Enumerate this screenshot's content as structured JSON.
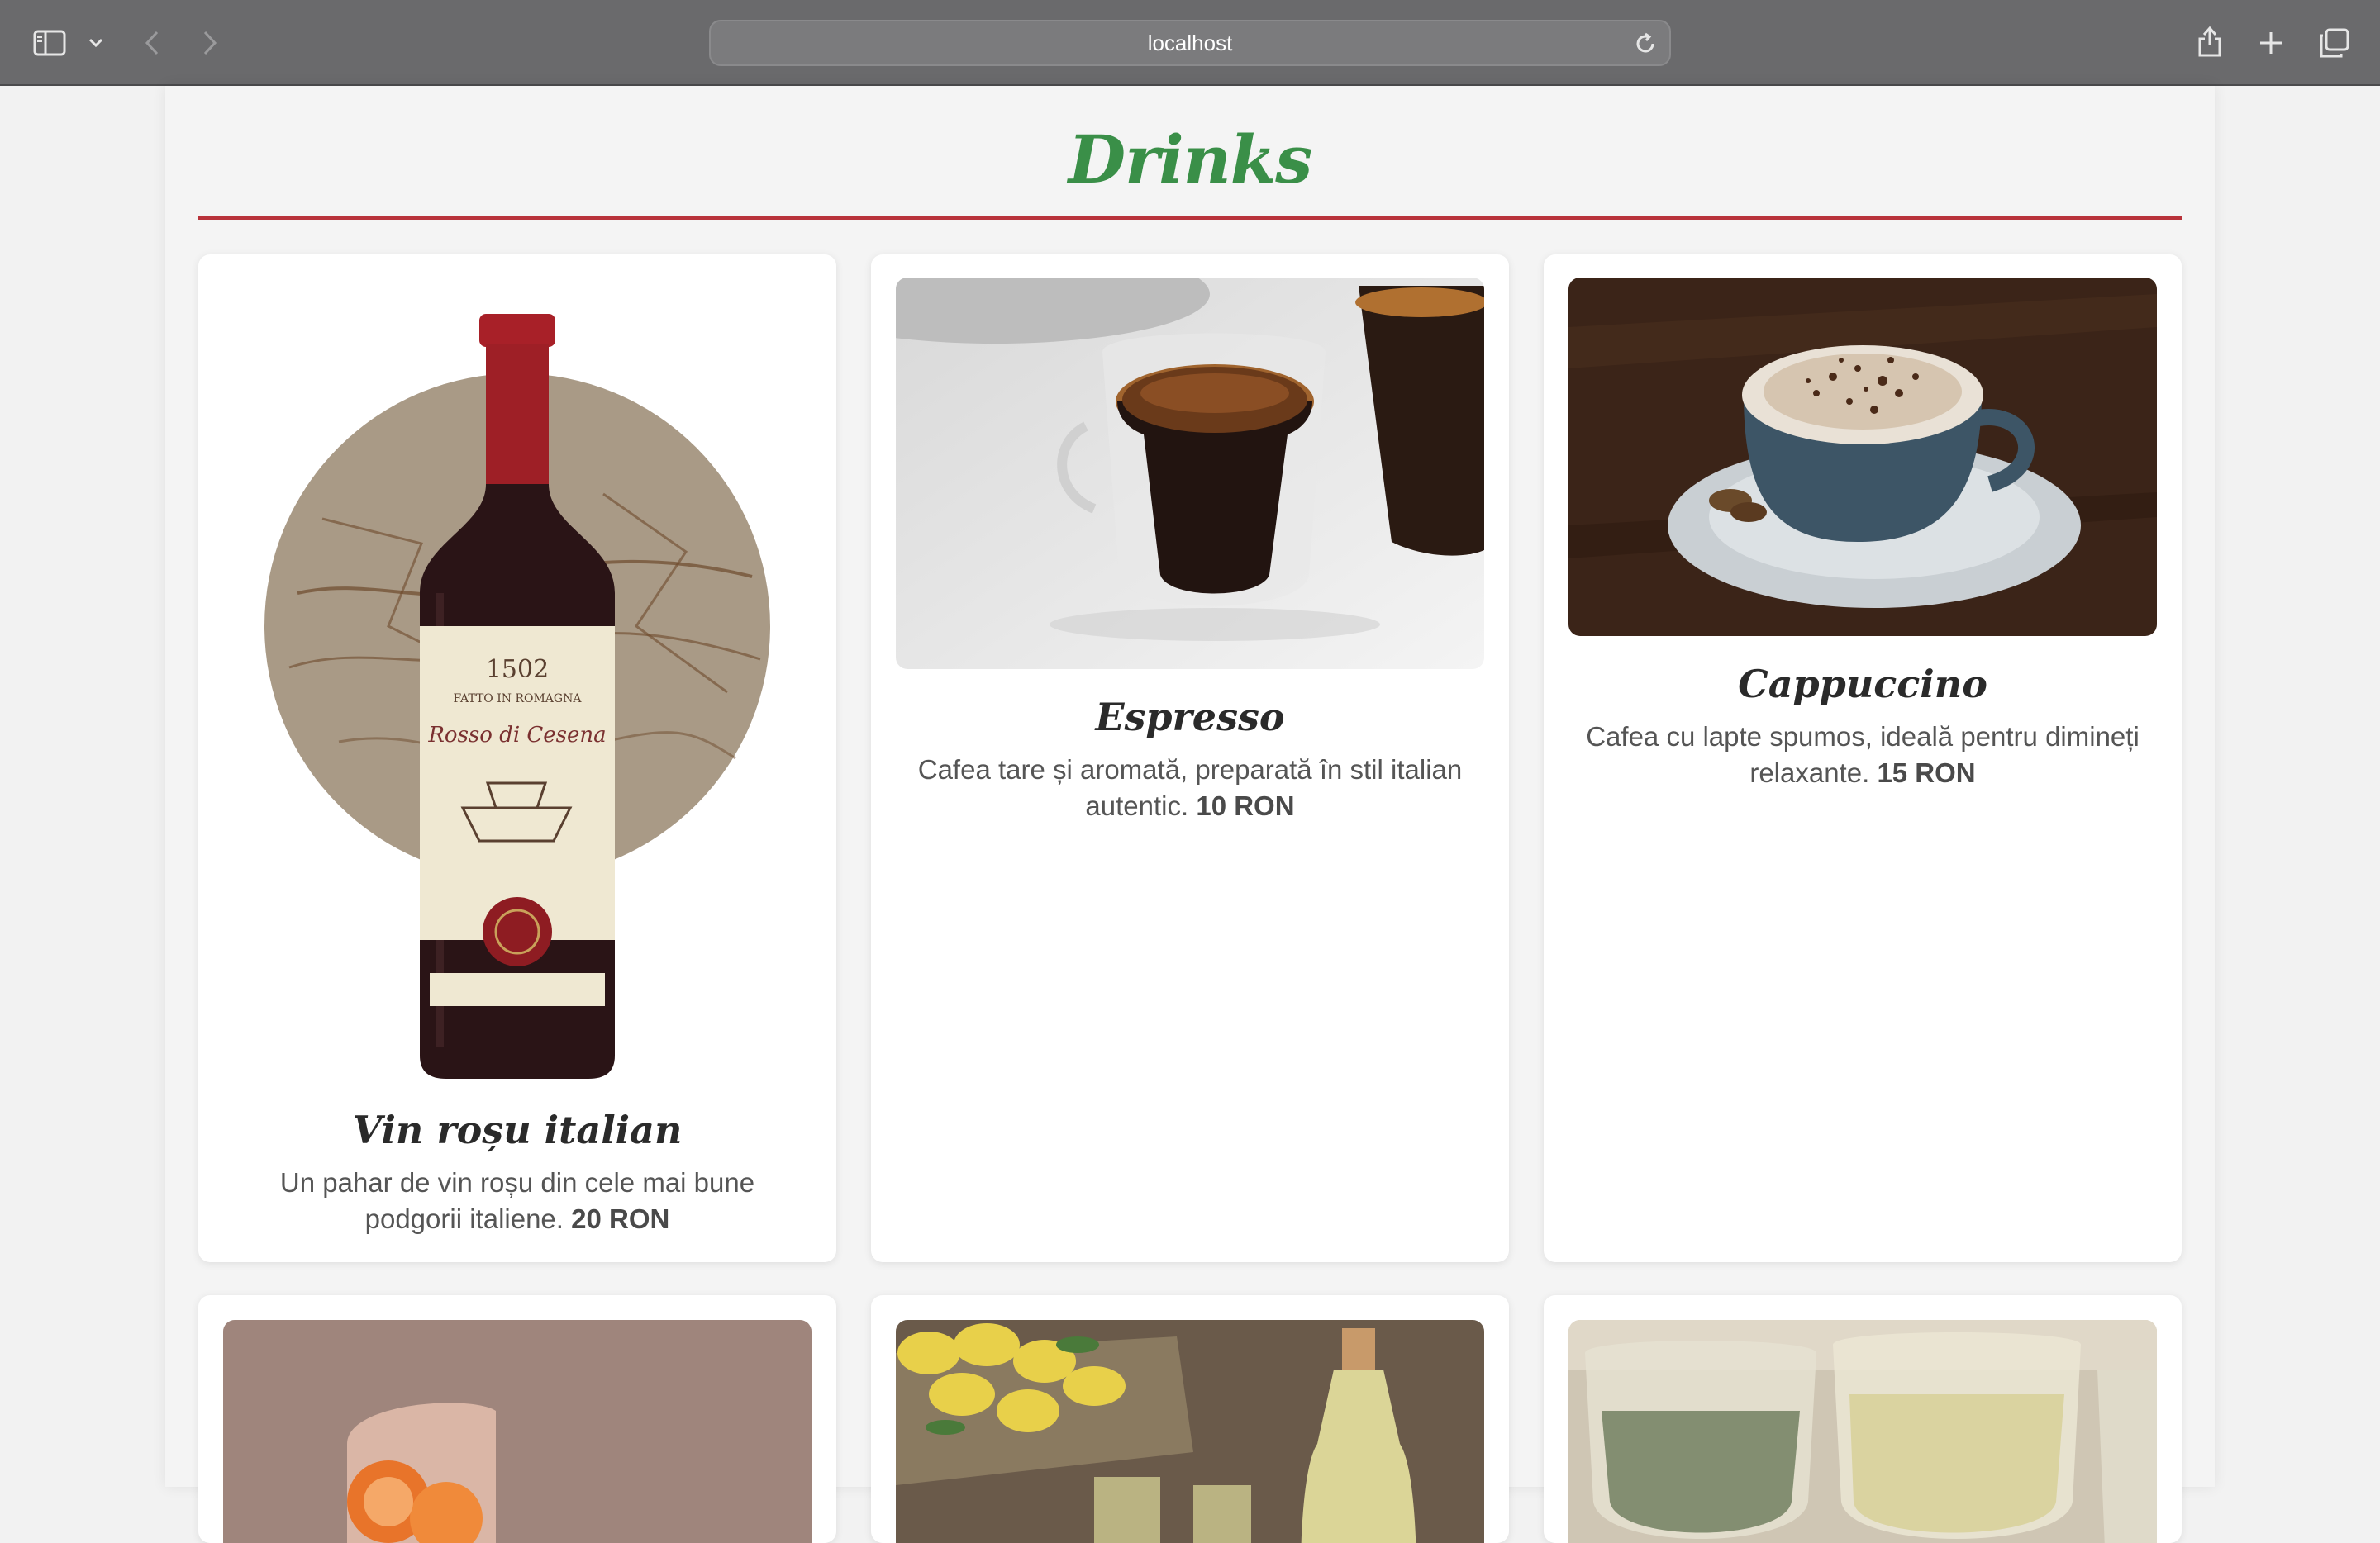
{
  "browser": {
    "url": "localhost",
    "icons": [
      "sidebar-icon",
      "chevron-down-icon",
      "back-icon",
      "forward-icon",
      "reload-icon",
      "share-icon",
      "plus-icon",
      "tabs-icon"
    ]
  },
  "section": {
    "title": "Drinks",
    "accent_color": "#3a8f48",
    "rule_color": "#b8323a"
  },
  "items": [
    {
      "name": "Vin roșu italian",
      "desc": "Un pahar de vin roșu din cele mai bune podgorii italiene.",
      "price": "20 RON",
      "image_label_1": "1502",
      "image_label_2": "FATTO IN ROMAGNA",
      "image_label_3": "Rosso di Cesena"
    },
    {
      "name": "Espresso",
      "desc": "Cafea tare și aromată, preparată în stil italian autentic.",
      "price": "10 RON"
    },
    {
      "name": "Cappuccino",
      "desc": "Cafea cu lapte spumos, ideală pentru dimineți relaxante.",
      "price": "15 RON"
    },
    {
      "name": "",
      "desc": "",
      "price": ""
    },
    {
      "name": "",
      "desc": "",
      "price": ""
    },
    {
      "name": "",
      "desc": "",
      "price": ""
    }
  ]
}
